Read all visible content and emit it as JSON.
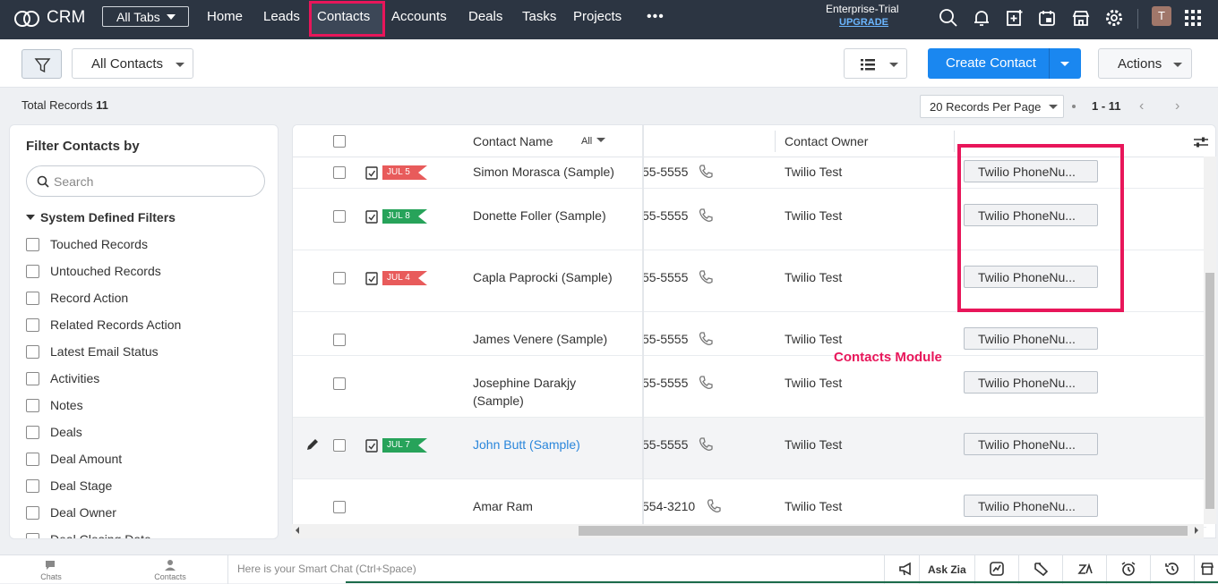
{
  "topbar": {
    "brand": "CRM",
    "all_tabs": "All Tabs",
    "nav": [
      "Home",
      "Leads",
      "Contacts",
      "Accounts",
      "Deals",
      "Tasks",
      "Projects"
    ],
    "more": "•••",
    "active_tab": "Contacts",
    "edition": "Enterprise-Trial",
    "upgrade": "UPGRADE",
    "avatar_initial": "T",
    "icons": [
      "search-icon",
      "bell-icon",
      "add-icon",
      "calendar-icon",
      "marketplace-icon",
      "gear-icon",
      "apps-icon"
    ]
  },
  "toolbar": {
    "view_select": "All Contacts",
    "create_button": "Create Contact",
    "actions_button": "Actions"
  },
  "records": {
    "total_label": "Total Records",
    "total_count": "11",
    "per_page": "20 Records Per Page",
    "range": "1 - 11"
  },
  "sidebar": {
    "title": "Filter Contacts by",
    "search_placeholder": "Search",
    "section": "System Defined Filters",
    "filters": [
      "Touched Records",
      "Untouched Records",
      "Record Action",
      "Related Records Action",
      "Latest Email Status",
      "Activities",
      "Notes",
      "Deals",
      "Deal Amount",
      "Deal Stage",
      "Deal Owner",
      "Deal Closing Date"
    ]
  },
  "grid": {
    "col_name": "Contact Name",
    "col_name_filter": "All",
    "col_owner": "Contact Owner",
    "button_label": "Twilio PhoneNu...",
    "rows": [
      {
        "tag": "JUL 5",
        "tag_color": "#e85b5b",
        "name": "Simon Morasca (Sample)",
        "phone": "55-5555",
        "owner": "Twilio Test"
      },
      {
        "tag": "JUL 8",
        "tag_color": "#27a35a",
        "name": "Donette Foller (Sample)",
        "phone": "55-5555",
        "owner": "Twilio Test"
      },
      {
        "tag": "JUL 4",
        "tag_color": "#e85b5b",
        "name": "Capla Paprocki (Sample)",
        "phone": "55-5555",
        "owner": "Twilio Test"
      },
      {
        "tag": "",
        "name": "James Venere (Sample)",
        "phone": "55-5555",
        "owner": "Twilio Test"
      },
      {
        "tag": "",
        "name": "Josephine Darakjy (Sample)",
        "phone": "55-5555",
        "owner": "Twilio Test"
      },
      {
        "tag": "JUL 7",
        "tag_color": "#27a35a",
        "name": "John Butt (Sample)",
        "phone": "55-5555",
        "owner": "Twilio Test"
      },
      {
        "tag": "",
        "name": "Amar Ram",
        "phone": "554-3210",
        "owner": "Twilio Test"
      }
    ]
  },
  "annotation": "Contacts Module",
  "bottombar": {
    "chats": "Chats",
    "contacts": "Contacts",
    "smart_chat_placeholder": "Here is your Smart Chat (Ctrl+Space)",
    "ask_zia": "Ask Zia"
  },
  "colors": {
    "accent": "#1a87f0",
    "highlight": "#e8165a",
    "topbar": "#2c3542"
  }
}
